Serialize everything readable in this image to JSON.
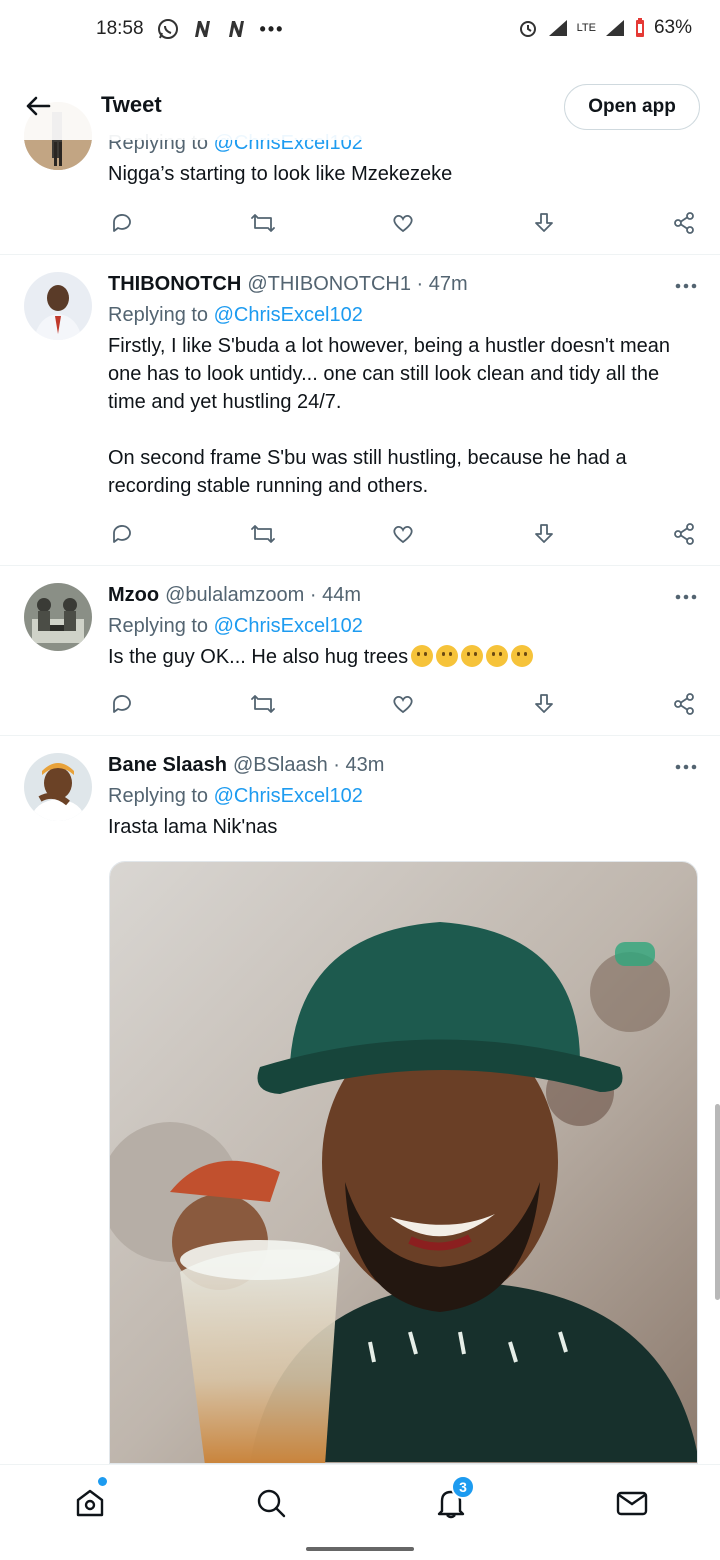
{
  "status_bar": {
    "time": "18:58",
    "battery": "63%",
    "network": "LTE"
  },
  "header": {
    "title": "Tweet",
    "open_app_label": "Open app"
  },
  "tweets": [
    {
      "replying_label": "Replying to",
      "mention": "@ChrisExcel102",
      "text": "Nigga’s starting to look like Mzekezeke"
    },
    {
      "name": "THIBONOTCH",
      "handle": "@THIBONOTCH1 · 47m",
      "replying_label": "Replying to",
      "mention": "@ChrisExcel102",
      "text_p1": "Firstly, I like S'buda a lot however, being a hustler doesn't mean one has to look untidy... one can still look clean and tidy all the time and yet hustling 24/7.",
      "text_p2": "On second frame S'bu was still hustling, because he had a recording stable running and others."
    },
    {
      "name": "Mzoo",
      "handle": "@bulalamzoom · 44m",
      "replying_label": "Replying to",
      "mention": "@ChrisExcel102",
      "text": "Is the guy OK... He also hug trees"
    },
    {
      "name": "Bane Slaash",
      "handle": "@BSlaash · 43m",
      "replying_label": "Replying to",
      "mention": "@ChrisExcel102",
      "text": "Irasta lama Nik'nas"
    }
  ],
  "bottom_nav": {
    "notifications_count": "3"
  },
  "colors": {
    "accent": "#1d9bf0",
    "secondary_text": "#536471",
    "divider": "#eff3f4"
  },
  "icons": [
    "back-arrow-icon",
    "reply-icon",
    "retweet-icon",
    "like-icon",
    "download-icon",
    "share-icon",
    "more-icon",
    "home-icon",
    "search-icon",
    "bell-icon",
    "mail-icon"
  ]
}
